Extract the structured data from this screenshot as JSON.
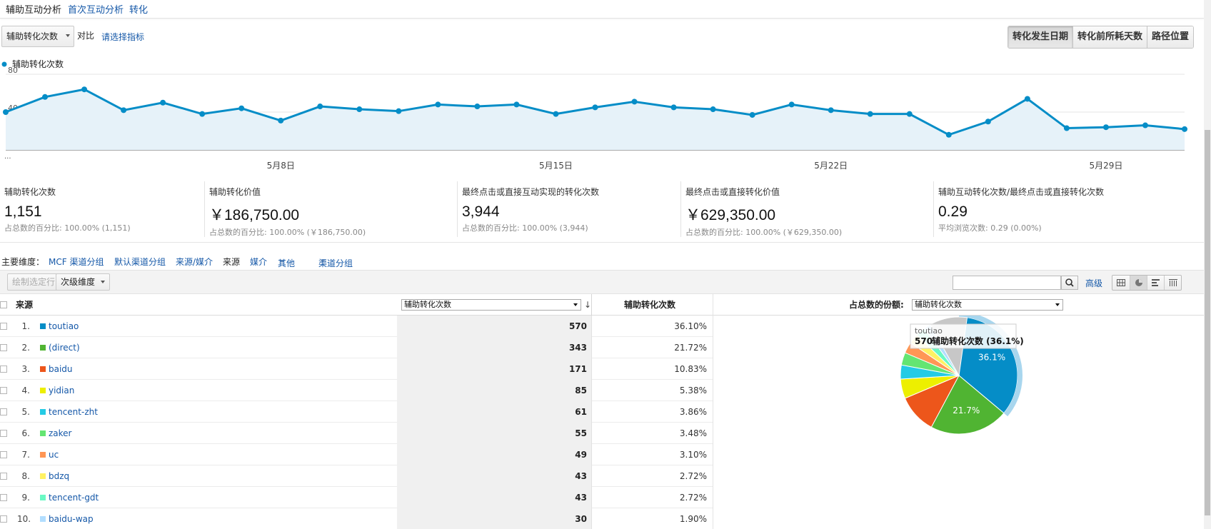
{
  "tabs": [
    "辅助互动分析",
    "首次互动分析",
    "转化"
  ],
  "metric_selector": {
    "value": "辅助转化次数",
    "compare_label": "对比",
    "select_link": "请选择指标"
  },
  "view_buttons": [
    "转化发生日期",
    "转化前所耗天数",
    "路径位置"
  ],
  "line_chart": {
    "legend": "辅助转化次数",
    "y_ticks": [
      "80",
      "40"
    ],
    "x_ticks": [
      "5月8日",
      "5月15日",
      "5月22日",
      "5月29日"
    ],
    "more_marker": "..."
  },
  "chart_data": {
    "type": "line",
    "series": [
      {
        "name": "辅助转化次数",
        "values": [
          40,
          56,
          64,
          42,
          50,
          38,
          44,
          31,
          46,
          43,
          41,
          48,
          46,
          48,
          38,
          45,
          51,
          45,
          43,
          37,
          48,
          42,
          38,
          38,
          16,
          30,
          54,
          23,
          24,
          26,
          22
        ]
      }
    ],
    "x_ticks": [
      "5月8日",
      "5月15日",
      "5月22日",
      "5月29日"
    ],
    "ylim": [
      0,
      80
    ],
    "color": "#058dc7"
  },
  "scorecards": [
    {
      "label": "辅助转化次数",
      "value": "1,151",
      "sub": "占总数的百分比: 100.00% (1,151)"
    },
    {
      "label": "辅助转化价值",
      "value": "￥186,750.00",
      "sub": "占总数的百分比: 100.00% (￥186,750.00)"
    },
    {
      "label": "最终点击或直接互动实现的转化次数",
      "value": "3,944",
      "sub": "占总数的百分比: 100.00% (3,944)"
    },
    {
      "label": "最终点击或直接转化价值",
      "value": "￥629,350.00",
      "sub": "占总数的百分比: 100.00% (￥629,350.00)"
    },
    {
      "label": "辅助互动转化次数/最终点击或直接转化次数",
      "value": "0.29",
      "sub": "平均浏览次数: 0.29 (0.00%)"
    }
  ],
  "dimensions": {
    "label": "主要维度：",
    "items": [
      "MCF 渠道分组",
      "默认渠道分组",
      "来源/媒介",
      "来源",
      "媒介",
      "其他",
      "渠道分组"
    ]
  },
  "toolbar": {
    "plot_rows": "绘制选定行",
    "secondary_dim": "次级维度",
    "advanced": "高级"
  },
  "table": {
    "col_source": "来源",
    "col_sort_select": "辅助转化次数",
    "col_metric": "辅助转化次数",
    "rows": [
      {
        "idx": "1.",
        "name": "toutiao",
        "value": "570",
        "pct": "36.10%",
        "color": "#058dc7"
      },
      {
        "idx": "2.",
        "name": "(direct)",
        "value": "343",
        "pct": "21.72%",
        "color": "#50b432"
      },
      {
        "idx": "3.",
        "name": "baidu",
        "value": "171",
        "pct": "10.83%",
        "color": "#ed561b"
      },
      {
        "idx": "4.",
        "name": "yidian",
        "value": "85",
        "pct": "5.38%",
        "color": "#edef00"
      },
      {
        "idx": "5.",
        "name": "tencent-zht",
        "value": "61",
        "pct": "3.86%",
        "color": "#24cbe5"
      },
      {
        "idx": "6.",
        "name": "zaker",
        "value": "55",
        "pct": "3.48%",
        "color": "#64e572"
      },
      {
        "idx": "7.",
        "name": "uc",
        "value": "49",
        "pct": "3.10%",
        "color": "#ff9655"
      },
      {
        "idx": "8.",
        "name": "bdzq",
        "value": "43",
        "pct": "2.72%",
        "color": "#fff263"
      },
      {
        "idx": "9.",
        "name": "tencent-gdt",
        "value": "43",
        "pct": "2.72%",
        "color": "#6af9c4"
      },
      {
        "idx": "10.",
        "name": "baidu-wap",
        "value": "30",
        "pct": "1.90%",
        "color": "#b2deff"
      }
    ]
  },
  "pie": {
    "header_label": "占总数的份额:",
    "select_value": "辅助转化次数",
    "labels": [
      "36.1%",
      "21.7%"
    ],
    "tooltip": {
      "name": "toutiao",
      "value": "570",
      "text": "辅助转化次数 (36.1%)"
    },
    "other_share": 0.1043,
    "other_color": "#c7c7c7"
  }
}
